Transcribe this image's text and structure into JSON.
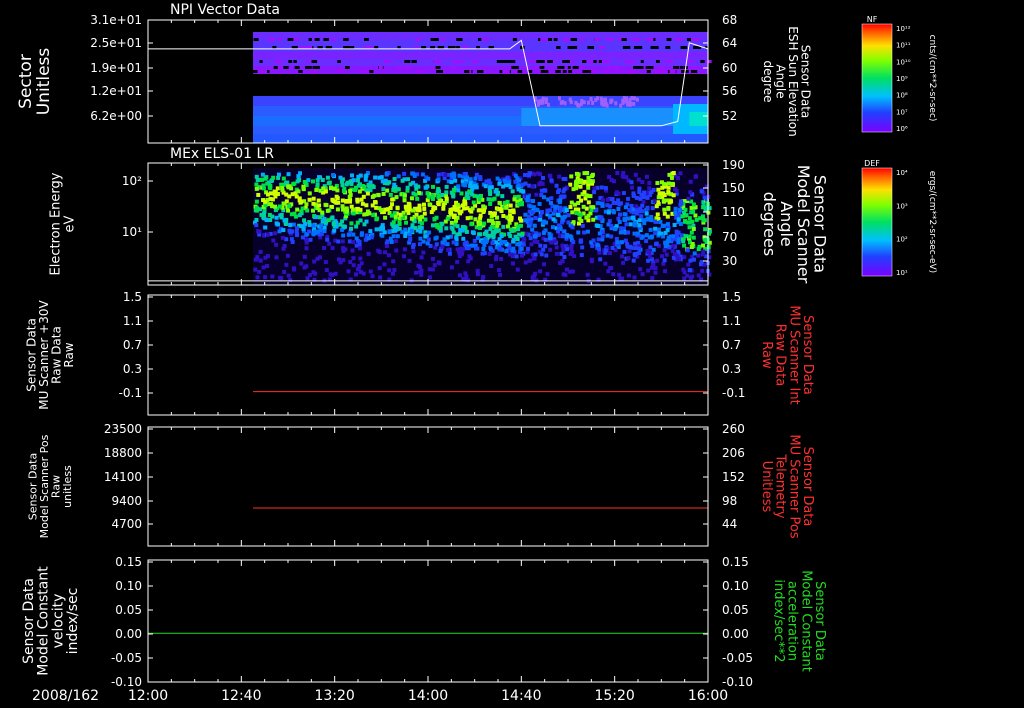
{
  "chart_data": [
    {
      "type": "heatmap",
      "title": "NPI Vector Data",
      "ylabel": "Sector\nUnitless",
      "yticks": [
        "3.1e+01",
        "2.5e+01",
        "1.9e+01",
        "1.2e+01",
        "6.2e+00"
      ],
      "right_label": "Sensor Data\nESH Sun Elevation\nAngle\ndegree",
      "right_ticks": [
        "68",
        "64",
        "60",
        "56",
        "52"
      ],
      "overlay_line": {
        "x": [
          "12:00",
          "12:45",
          "14:35",
          "14:40",
          "14:48",
          "15:40",
          "15:47",
          "15:52",
          "16:00"
        ],
        "y": [
          63.3,
          63.3,
          63.3,
          64.7,
          50.8,
          50.8,
          51.5,
          64.3,
          63.3
        ]
      },
      "colorbar": {
        "label": "cnts/(cm**2-sr-sec)",
        "name": "NF",
        "ticks": [
          "10¹²",
          "10¹¹",
          "10¹⁰",
          "10⁹",
          "10⁸",
          "10⁷",
          "10⁶"
        ]
      }
    },
    {
      "type": "heatmap",
      "title": "MEx ELS-01 LR",
      "ylabel": "Electron Energy\neV",
      "yticks": [
        "10²",
        "10¹"
      ],
      "right_label": "Sensor Data\nModel Scanner\nAngle\ndegrees",
      "right_ticks": [
        "190",
        "150",
        "110",
        "70",
        "30"
      ],
      "overlay_line": {
        "x": [
          "12:00",
          "16:00"
        ],
        "y": [
          16,
          16
        ]
      },
      "colorbar": {
        "label": "ergs/(cm**2-sr-sec-eV)",
        "name": "DEF",
        "ticks": [
          "10⁴",
          "10³",
          "10²",
          "10¹"
        ]
      }
    },
    {
      "type": "line",
      "ylabel": "Sensor Data\nMU Scanner +30V\nRaw Data\nRaw",
      "yticks": [
        "1.5",
        "1.1",
        "0.7",
        "0.3",
        "-0.1"
      ],
      "ylim": [
        -0.3,
        1.5
      ],
      "right_label": "Sensor Data\nMU Scanner Int\nRaw Data\nRaw",
      "right_ticks": [
        "1.5",
        "1.1",
        "0.7",
        "0.3",
        "-0.1"
      ],
      "series": [
        {
          "color": "#ff3030",
          "x": [
            "12:45",
            "16:00"
          ],
          "y": [
            0.05,
            0.05
          ]
        }
      ]
    },
    {
      "type": "line",
      "ylabel": "Sensor Data\nModel Scanner Pos\nRaw\nunitless",
      "yticks": [
        "23500",
        "18800",
        "14100",
        "9400",
        "4700"
      ],
      "ylim": [
        0,
        23500
      ],
      "right_label": "Sensor Data\nMU Scanner Pos\nTelemetry\nUnitless",
      "right_ticks": [
        "260",
        "206",
        "152",
        "98",
        "44"
      ],
      "series": [
        {
          "color": "#ff3030",
          "x": [
            "12:45",
            "16:00"
          ],
          "y": [
            7500,
            7500
          ]
        }
      ]
    },
    {
      "type": "line",
      "ylabel": "Sensor Data\nModel Constant\nvelocity\nindex/sec",
      "yticks": [
        "0.15",
        "0.10",
        "0.05",
        "0.00",
        "-0.05",
        "-0.10"
      ],
      "ylim": [
        -0.1,
        0.15
      ],
      "right_label": "Sensor Data\nModel Constant\nacceleration\nindex/sec**2",
      "right_ticks": [
        "0.15",
        "0.10",
        "0.05",
        "0.00",
        "-0.05",
        "-0.10"
      ],
      "series": [
        {
          "color": "#20dd20",
          "x": [
            "12:00",
            "16:00"
          ],
          "y": [
            0.0,
            0.0
          ]
        }
      ]
    }
  ],
  "xaxis": {
    "date": "2008/162",
    "ticks": [
      "12:00",
      "12:40",
      "13:20",
      "14:00",
      "14:40",
      "15:20",
      "16:00"
    ]
  },
  "colors": {
    "right_label_panel3": "#ff3030",
    "right_label_panel4": "#ff3030",
    "right_label_panel5": "#20dd20"
  }
}
